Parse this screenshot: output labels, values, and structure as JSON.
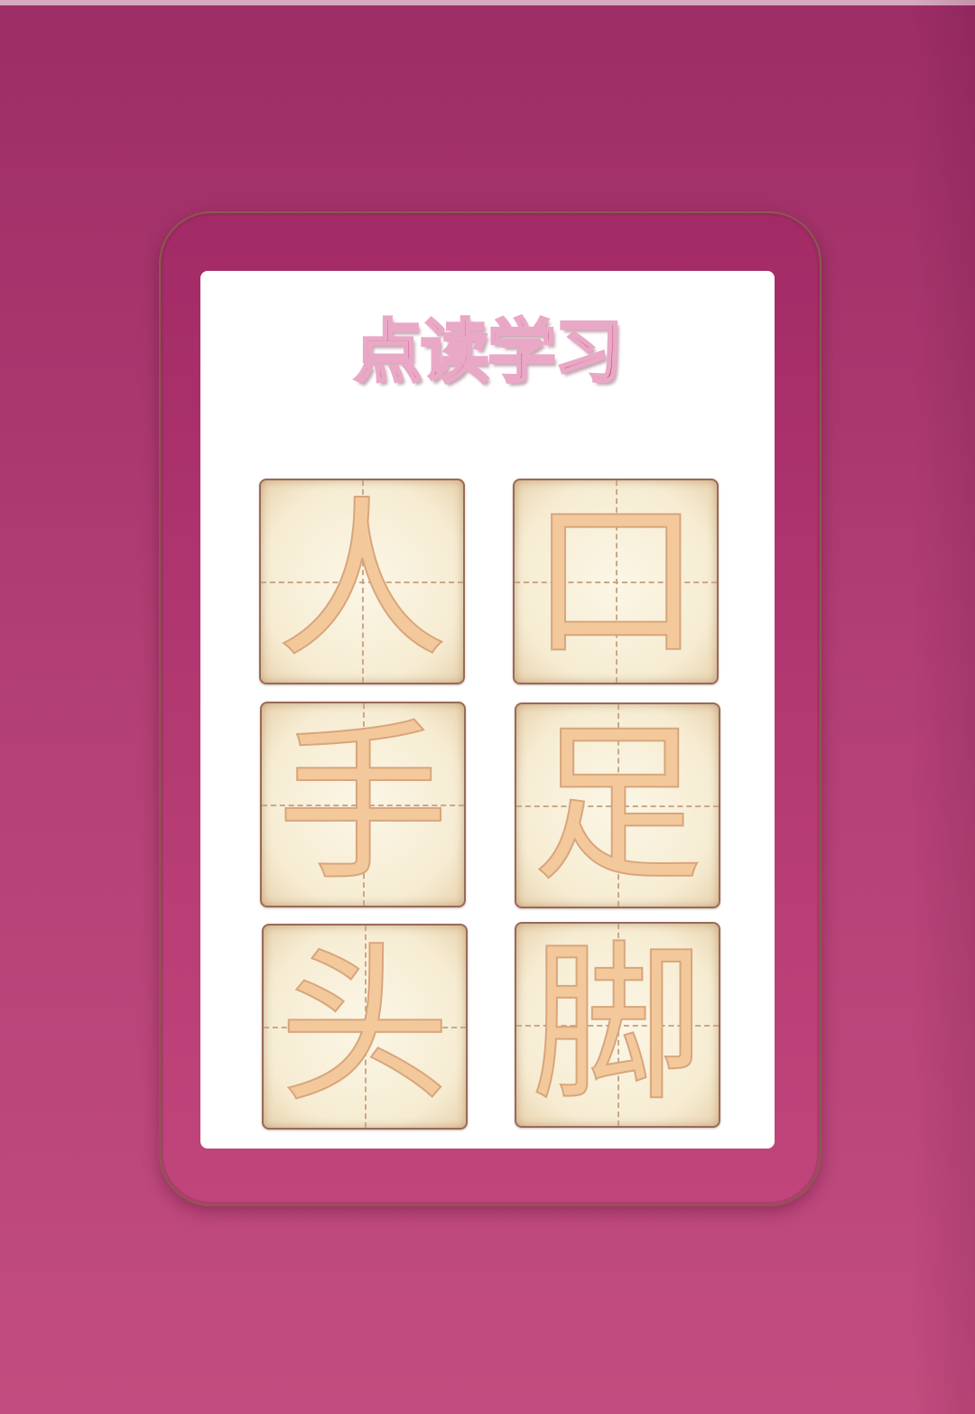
{
  "screen": {
    "title": "点读学习"
  },
  "tiles": [
    {
      "char": "人"
    },
    {
      "char": "口"
    },
    {
      "char": "手"
    },
    {
      "char": "足"
    },
    {
      "char": "头"
    },
    {
      "char": "脚"
    }
  ],
  "colors": {
    "background": "#b13e74",
    "frame": "#a22a66",
    "panel": "#ffffff",
    "title_fill": "#b0386c",
    "title_outline": "#e9a8c6",
    "tile_paper": "#f6ecd2",
    "tile_glyph": "#f3c99c"
  }
}
